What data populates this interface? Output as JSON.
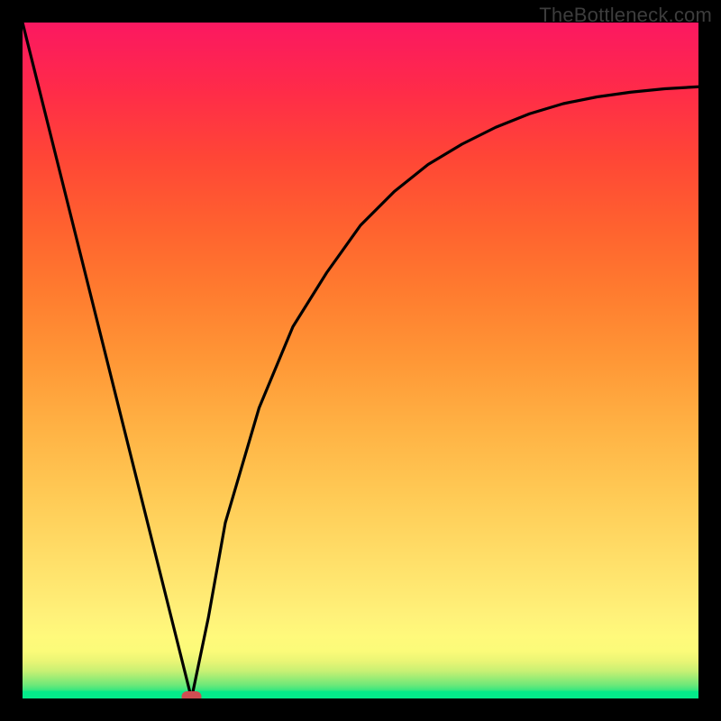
{
  "watermark": "TheBottleneck.com",
  "chart_data": {
    "type": "line",
    "title": "",
    "xlabel": "",
    "ylabel": "",
    "xlim": [
      0,
      100
    ],
    "ylim": [
      0,
      100
    ],
    "series": [
      {
        "name": "bottleneck-curve",
        "x": [
          0,
          5,
          10,
          15,
          20,
          22.5,
          25,
          27.5,
          30,
          35,
          40,
          45,
          50,
          55,
          60,
          65,
          70,
          75,
          80,
          85,
          90,
          95,
          100
        ],
        "values": [
          100,
          80,
          60,
          40,
          20,
          10,
          0,
          12,
          26,
          43,
          55,
          63,
          70,
          75,
          79,
          82,
          84.5,
          86.5,
          88,
          89,
          89.7,
          90.2,
          90.5
        ]
      }
    ],
    "marker": {
      "x": 25,
      "y": 0
    },
    "background_bands": [
      {
        "from": 0,
        "to": 1,
        "color": "#04ea8a"
      },
      {
        "from": 1,
        "to": 2,
        "color": "#3ee77e"
      },
      {
        "from": 2,
        "to": 3.5,
        "color": "#81ea77"
      },
      {
        "from": 3.5,
        "to": 5,
        "color": "#b8ef74"
      },
      {
        "from": 5,
        "to": 7,
        "color": "#e4f474"
      },
      {
        "from": 7,
        "to": 10,
        "color": "#fbfb79"
      },
      {
        "from": 10,
        "to": 15,
        "color": "#fff27a"
      },
      {
        "from": 15,
        "to": 100,
        "gradient": [
          "#ffe874",
          "#ffd35b",
          "#ffb945",
          "#ff9a35",
          "#ff7a2d",
          "#ff5a2d",
          "#ff3a3a",
          "#ff1f55",
          "#fb1861"
        ]
      }
    ]
  }
}
